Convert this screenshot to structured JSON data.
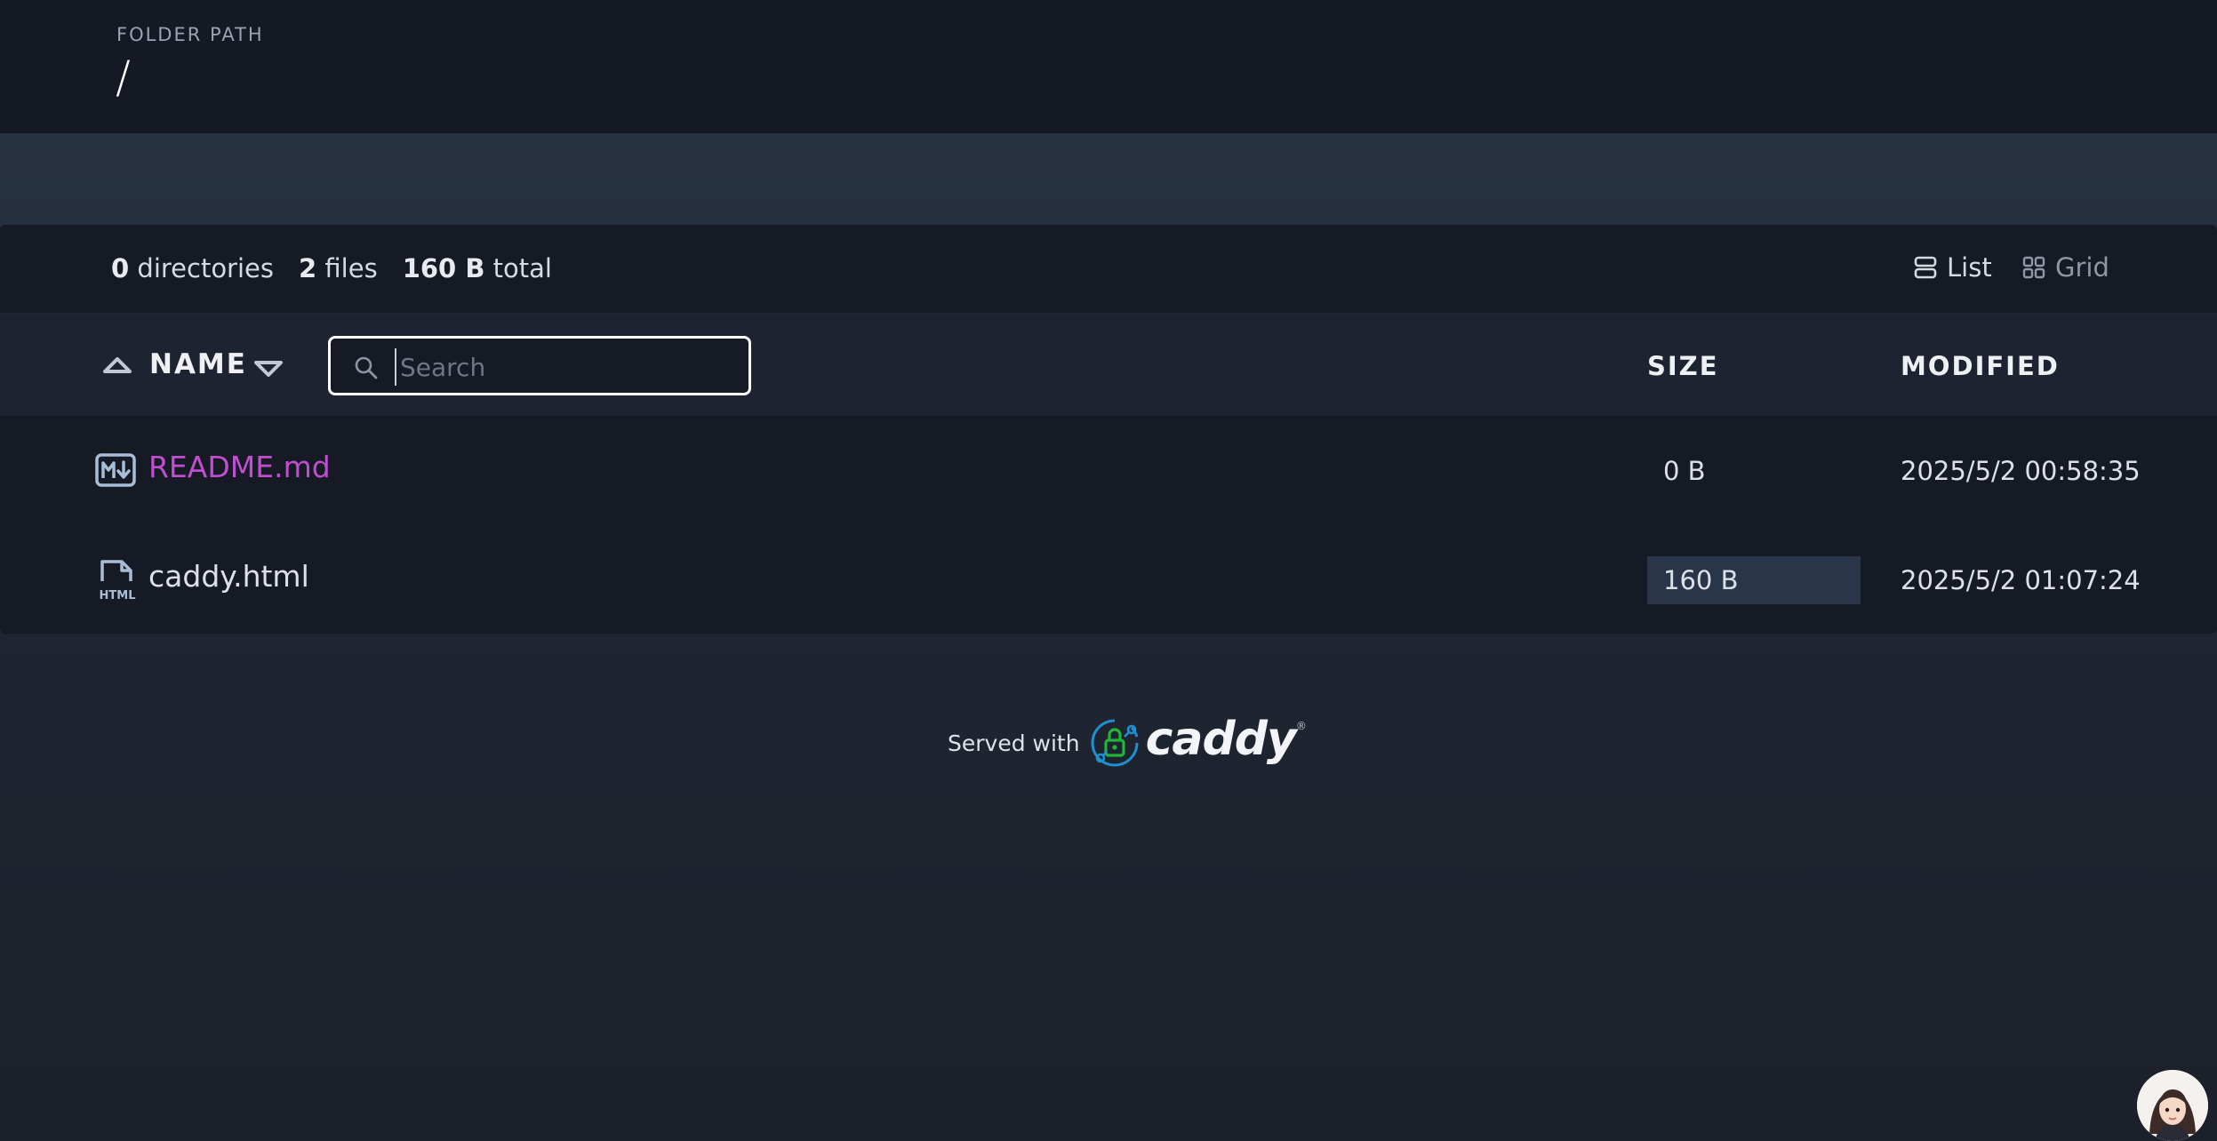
{
  "header": {
    "folder_label": "FOLDER PATH",
    "folder_path": "/"
  },
  "summary": {
    "dir_count": "0",
    "dir_label": "directories",
    "file_count": "2",
    "file_label": "files",
    "total_size": "160 B",
    "total_label": "total"
  },
  "view": {
    "list_label": "List",
    "grid_label": "Grid",
    "active": "list"
  },
  "table": {
    "col_name": "NAME",
    "col_size": "SIZE",
    "col_modified": "MODIFIED",
    "search_placeholder": "Search",
    "search_value": "",
    "rows": [
      {
        "icon": "markdown-file-icon",
        "name": "README.md",
        "size": "0 B",
        "modified": "2025/5/2 00:58:35"
      },
      {
        "icon": "html-file-icon",
        "name": "caddy.html",
        "size": "160 B",
        "modified": "2025/5/2 01:07:24"
      }
    ]
  },
  "footer": {
    "served_with": "Served with",
    "brand": "caddy",
    "brand_mark": "®"
  },
  "colors": {
    "topbar": "#141923",
    "panel": "#151a24",
    "header_row": "#1d2330",
    "markdown_link": "#c14dd1",
    "size_highlight": "#293548",
    "caddy_green": "#22b638",
    "caddy_blue": "#00a0e0"
  }
}
